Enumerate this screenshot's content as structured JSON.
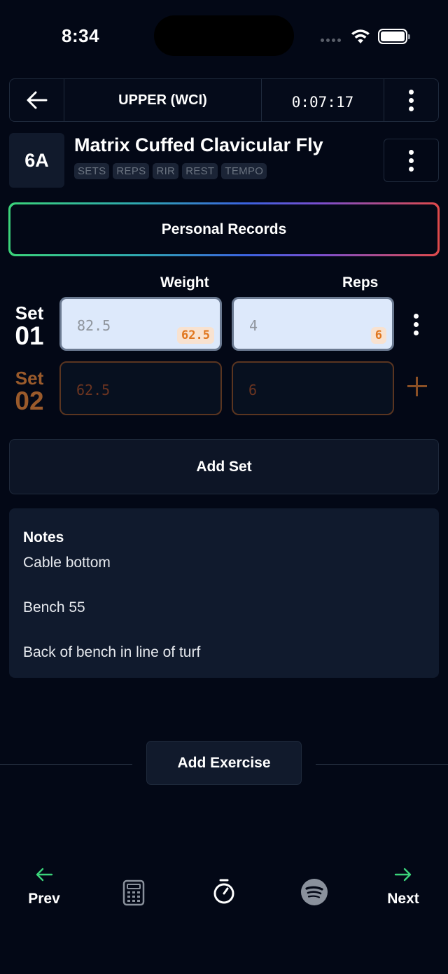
{
  "status_bar": {
    "time": "8:34"
  },
  "header": {
    "title": "UPPER (WCI)",
    "timer": "0:07:17"
  },
  "exercise": {
    "code": "6A",
    "name": "Matrix Cuffed Clavicular Fly",
    "tags": [
      "SETS",
      "REPS",
      "RIR",
      "REST",
      "TEMPO"
    ]
  },
  "personal_records_label": "Personal Records",
  "columns": {
    "weight": "Weight",
    "reps": "Reps"
  },
  "sets": [
    {
      "word": "Set",
      "number": "01",
      "weight_placeholder": "82.5",
      "weight_prev": "62.5",
      "reps_placeholder": "4",
      "reps_prev": "6"
    },
    {
      "word": "Set",
      "number": "02",
      "weight": "62.5",
      "reps": "6"
    }
  ],
  "add_set_label": "Add Set",
  "notes": {
    "title": "Notes",
    "lines": [
      "Cable bottom",
      "Bench 55",
      "Back of bench in line of turf"
    ]
  },
  "add_exercise_label": "Add Exercise",
  "bottom_nav": {
    "prev": "Prev",
    "next": "Next"
  },
  "colors": {
    "accent_green": "#3bd37a",
    "accent_orange": "#e0761e",
    "background": "#030816"
  }
}
